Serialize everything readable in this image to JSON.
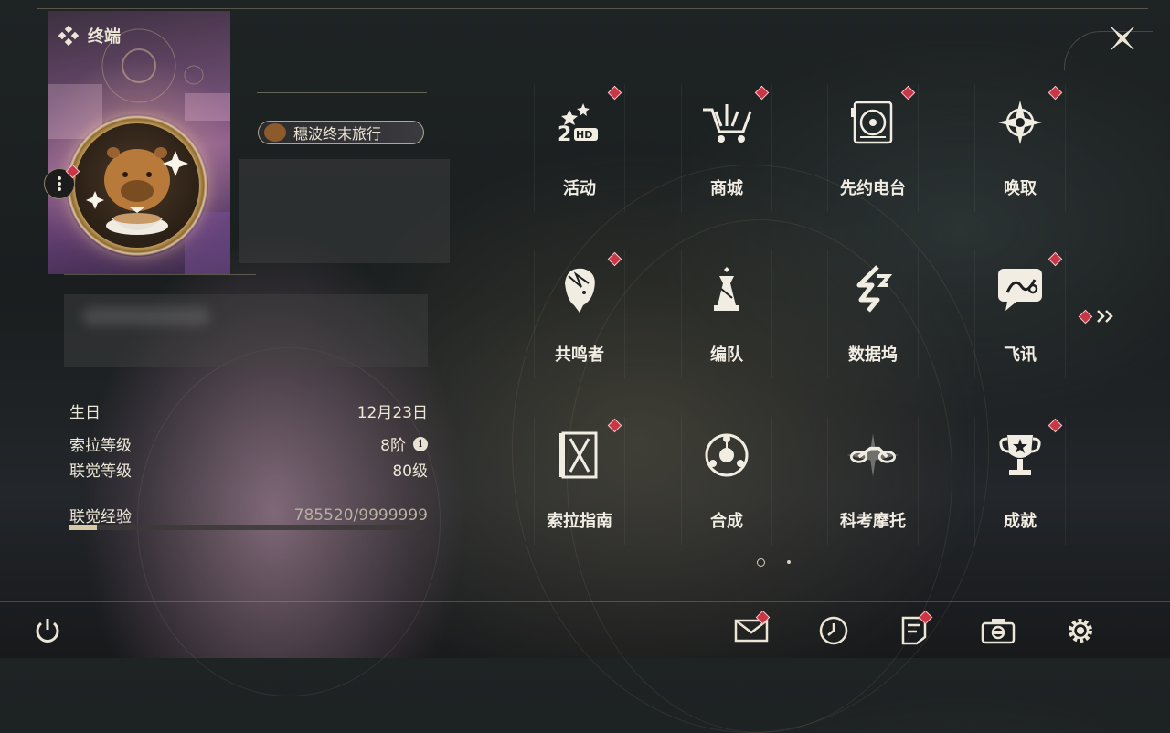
{
  "header": {
    "title": "终端"
  },
  "profile": {
    "title_badge": "穗波终末旅行",
    "stats": [
      {
        "label": "生日",
        "value": "12月23日"
      },
      {
        "label": "索拉等级",
        "value": "8阶"
      },
      {
        "label": "联觉等级",
        "value": "80级"
      }
    ],
    "experience": {
      "label": "联觉经验",
      "value": "785520/9999999",
      "progress": 0.0786
    }
  },
  "menu": {
    "items": [
      {
        "label": "活动",
        "icon": "2nd-anniversary-icon",
        "notify": true
      },
      {
        "label": "商城",
        "icon": "crown-cart-icon",
        "notify": true
      },
      {
        "label": "先约电台",
        "icon": "radio-disc-icon",
        "notify": true
      },
      {
        "label": "唤取",
        "icon": "compass-star-icon",
        "notify": true
      },
      {
        "label": "共鸣者",
        "icon": "character-portrait-icon",
        "notify": true
      },
      {
        "label": "编队",
        "icon": "chess-pieces-icon",
        "notify": false
      },
      {
        "label": "数据坞",
        "icon": "data-dock-icon",
        "notify": false
      },
      {
        "label": "飞讯",
        "icon": "chat-bubble-icon",
        "notify": true
      },
      {
        "label": "索拉指南",
        "icon": "guide-book-icon",
        "notify": true
      },
      {
        "label": "合成",
        "icon": "synthesis-orb-icon",
        "notify": false
      },
      {
        "label": "科考摩托",
        "icon": "motorbike-icon",
        "notify": false
      },
      {
        "label": "成就",
        "icon": "trophy-icon",
        "notify": true
      }
    ],
    "page": 1,
    "page_count": 2
  },
  "bottom_bar": {
    "items": [
      {
        "icon": "mail-icon",
        "notify": true
      },
      {
        "icon": "clock-icon",
        "notify": false
      },
      {
        "icon": "notes-icon",
        "notify": true
      },
      {
        "icon": "camera-icon",
        "notify": false
      },
      {
        "icon": "settings-gear-icon",
        "notify": false
      }
    ]
  },
  "colors": {
    "accent": "#d9c8a8",
    "notify": "#c93747",
    "text": "#ece6d6"
  }
}
